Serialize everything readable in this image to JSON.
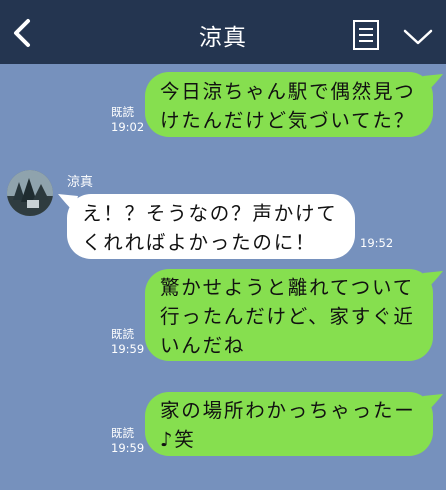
{
  "header": {
    "title": "涼真",
    "back_icon": "chevron-left-icon",
    "menu_icon": "notes-icon",
    "expand_icon": "chevron-down-icon"
  },
  "colors": {
    "header_bg": "#243550",
    "chat_bg": "#7691bd",
    "outgoing_bubble": "#86df4f",
    "incoming_bubble": "#ffffff"
  },
  "messages": [
    {
      "direction": "outgoing",
      "text": "今日涼ちゃん駅で偶然見つ\nけたんだけど気づいてた？",
      "read": "既読",
      "time": "19:02"
    },
    {
      "direction": "incoming",
      "sender": "涼真",
      "text": "え！？そうなの？声かけて\nくれればよかったのに！",
      "time": "19:52"
    },
    {
      "direction": "outgoing",
      "text": "驚かせようと離れてついて\n行ったんだけど、家すぐ近\nいんだね",
      "read": "既読",
      "time": "19:59"
    },
    {
      "direction": "outgoing",
      "text": "家の場所わかっちゃったー\n♪笑",
      "read": "既読",
      "time": "19:59"
    }
  ]
}
